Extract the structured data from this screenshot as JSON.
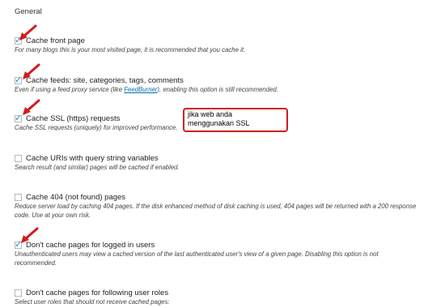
{
  "section": {
    "title": "General"
  },
  "options": [
    {
      "label": "Cache front page",
      "checked": true,
      "desc": "For many blogs this is your most visited page, it is recommended that you cache it."
    },
    {
      "label": "Cache feeds: site, categories, tags, comments",
      "checked": true,
      "desc_before": "Even if using a feed proxy service (like ",
      "desc_link": "FeedBurner",
      "desc_after": "), enabling this option is still recommended."
    },
    {
      "label": "Cache SSL (https) requests",
      "checked": true,
      "desc": "Cache SSL requests (uniquely) for improved performance."
    },
    {
      "label": "Cache URIs with query string variables",
      "checked": false,
      "desc": "Search result (and similar) pages will be cached if enabled."
    },
    {
      "label": "Cache 404 (not found) pages",
      "checked": false,
      "desc_line1": "Reduce server load by caching 404 pages. If the disk enhanced method of disk caching is used, 404 pages will be returned with a 200 response",
      "desc_line2": "code. Use at your own risk."
    },
    {
      "label": "Don't cache pages for logged in users",
      "checked": true,
      "desc_line1": "Unauthenticated users may view a cached version of the last authenticated user's view of a given page. Disabling this option is not",
      "desc_line2": "recommended."
    },
    {
      "label": "Don't cache pages for following user roles",
      "checked": false,
      "desc": "Select user roles that should not receive cached pages:"
    }
  ],
  "callout": {
    "line1": "jika web anda",
    "line2": "menggunakan SSL"
  },
  "colors": {
    "arrow": "#d41a1a",
    "callout_border": "#d41a1a",
    "link": "#0073aa",
    "check": "#1e8cbe"
  }
}
